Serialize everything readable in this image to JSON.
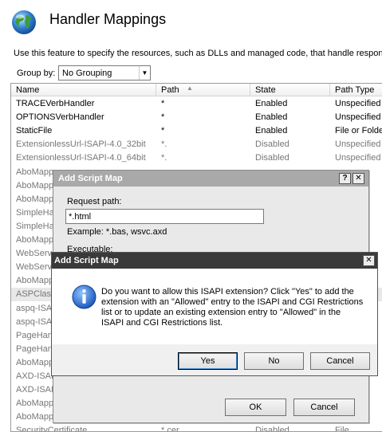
{
  "header": {
    "title": "Handler Mappings",
    "description": "Use this feature to specify the resources, such as DLLs and managed code, that handle respons"
  },
  "groupby": {
    "label": "Group by:",
    "value": "No Grouping"
  },
  "columns": {
    "name": "Name",
    "path": "Path",
    "state": "State",
    "pathtype": "Path Type"
  },
  "rows": [
    {
      "name": "TRACEVerbHandler",
      "path": "*",
      "state": "Enabled",
      "pathtype": "Unspecified"
    },
    {
      "name": "OPTIONSVerbHandler",
      "path": "*",
      "state": "Enabled",
      "pathtype": "Unspecified"
    },
    {
      "name": "StaticFile",
      "path": "*",
      "state": "Enabled",
      "pathtype": "File or Folde"
    },
    {
      "name": "ExtensionlessUrl-ISAPI-4.0_32bit",
      "path": "*.",
      "state": "Disabled",
      "pathtype": "Unspecified"
    },
    {
      "name": "ExtensionlessUrl-ISAPI-4.0_64bit",
      "path": "*.",
      "state": "Disabled",
      "pathtype": "Unspecified"
    },
    {
      "name": "AboMappe",
      "path": "",
      "state": "",
      "pathtype": ""
    },
    {
      "name": "AboMappe",
      "path": "",
      "state": "",
      "pathtype": ""
    },
    {
      "name": "AboMappe",
      "path": "",
      "state": "",
      "pathtype": ""
    },
    {
      "name": "SimpleHar",
      "path": "",
      "state": "",
      "pathtype": ""
    },
    {
      "name": "SimpleHar",
      "path": "",
      "state": "",
      "pathtype": ""
    },
    {
      "name": "AboMappe",
      "path": "",
      "state": "",
      "pathtype": ""
    },
    {
      "name": "WebServ",
      "path": "",
      "state": "",
      "pathtype": ""
    },
    {
      "name": "WebServ",
      "path": "",
      "state": "",
      "pathtype": ""
    },
    {
      "name": "AboMappe",
      "path": "",
      "state": "",
      "pathtype": ""
    },
    {
      "name": "ASPClass",
      "path": "",
      "state": "",
      "pathtype": ""
    },
    {
      "name": "aspq-ISA",
      "path": "",
      "state": "",
      "pathtype": ""
    },
    {
      "name": "aspq-ISA",
      "path": "",
      "state": "",
      "pathtype": ""
    },
    {
      "name": "PageHan",
      "path": "",
      "state": "",
      "pathtype": ""
    },
    {
      "name": "PageHan",
      "path": "",
      "state": "",
      "pathtype": ""
    },
    {
      "name": "AboMappe",
      "path": "",
      "state": "",
      "pathtype": ""
    },
    {
      "name": "AXD-ISAI",
      "path": "",
      "state": "",
      "pathtype": ""
    },
    {
      "name": "AXD-ISAP",
      "path": "",
      "state": "",
      "pathtype": ""
    },
    {
      "name": "AboMappe",
      "path": "",
      "state": "",
      "pathtype": ""
    },
    {
      "name": "AboMappe",
      "path": "",
      "state": "",
      "pathtype": ""
    },
    {
      "name": "SecurityCertificate",
      "path": "*.cer",
      "state": "Disabled",
      "pathtype": "File"
    }
  ],
  "dialog_back": {
    "title": "Add Script Map",
    "help": "?",
    "close": "✕",
    "request_path_label": "Request path:",
    "request_path_value": "*.html",
    "example": "Example: *.bas, wsvc.axd",
    "executable_label": "Executable:",
    "ok": "OK",
    "cancel": "Cancel"
  },
  "dialog_front": {
    "title": "Add Script Map",
    "close": "✕",
    "message": "Do you want to allow this ISAPI extension? Click \"Yes\" to add the extension with an \"Allowed\" entry to the ISAPI and CGI Restrictions list or to update an existing extension entry to \"Allowed\" in the ISAPI and CGI Restrictions list.",
    "yes": "Yes",
    "no": "No",
    "cancel": "Cancel",
    "icon": "info-icon"
  }
}
